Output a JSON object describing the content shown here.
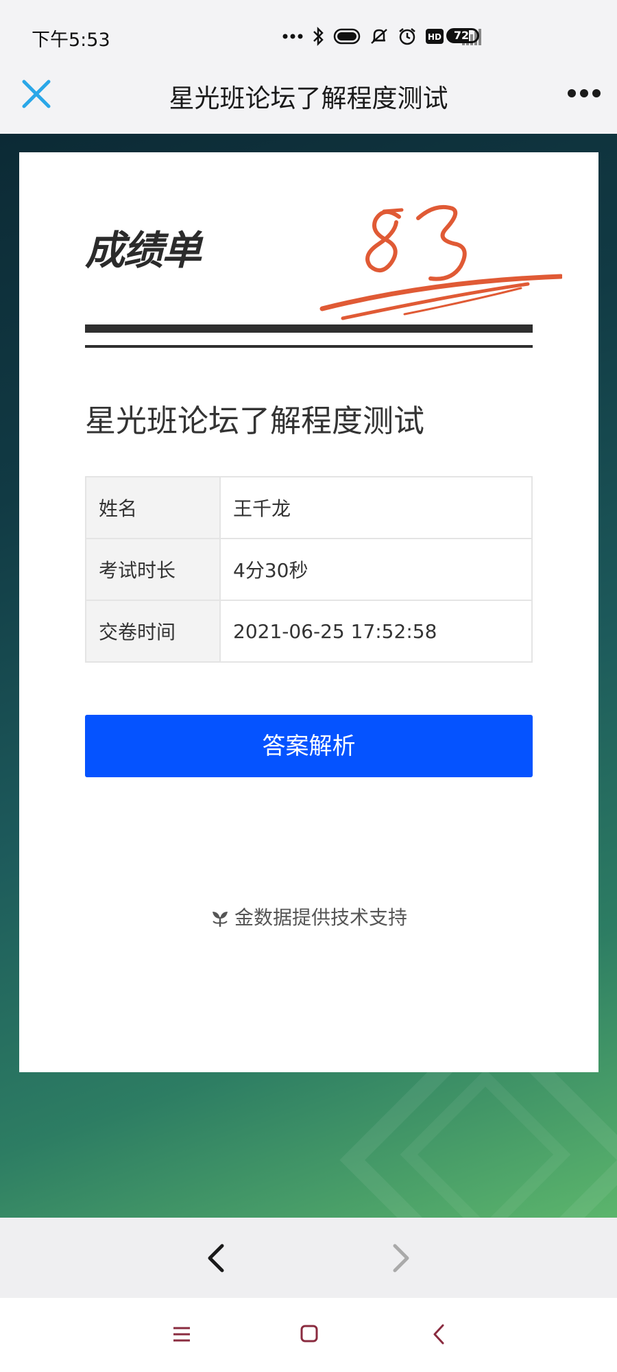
{
  "status_bar": {
    "time": "下午5:53",
    "battery": "72",
    "network": "4G",
    "icons": [
      "more-dots-icon",
      "bluetooth-icon",
      "toggle-icon",
      "mute-icon",
      "alarm-icon",
      "hd-icon",
      "signal-icon",
      "battery-icon"
    ]
  },
  "title_bar": {
    "title": "星光班论坛了解程度测试",
    "close_icon": "close-icon",
    "more_icon": "more-icon",
    "accent_color": "#2aa7e8"
  },
  "card": {
    "heading": "成绩单",
    "score": "83",
    "score_color": "#e05a35",
    "exam_title": "星光班论坛了解程度测试",
    "info": [
      {
        "label": "姓名",
        "value": "王千龙"
      },
      {
        "label": "考试时长",
        "value": "4分30秒"
      },
      {
        "label": "交卷时间",
        "value": "2021-06-25 17:52:58"
      }
    ],
    "button_label": "答案解析",
    "button_color": "#0553ff",
    "powered_by": "金数据提供技术支持"
  },
  "browser_nav": {
    "back": "back-icon",
    "forward": "forward-icon"
  },
  "system_nav": {
    "items": [
      "menu-icon",
      "home-icon",
      "back-icon"
    ]
  }
}
